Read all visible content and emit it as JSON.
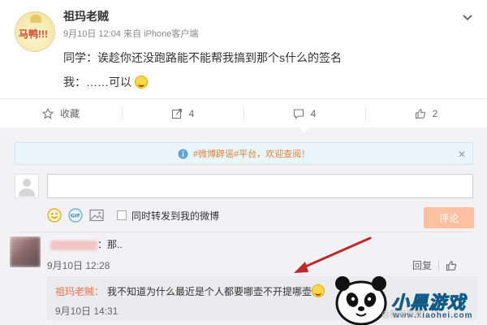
{
  "post": {
    "avatar_text": "马鸭!!!",
    "username": "祖玛老贼",
    "timestamp": "9月10日 12:04",
    "source_prefix": "来自",
    "source": "iPhone客户端",
    "content_line1": "同学：诶趁你还没跑路能不能帮我搞到那个s什么的签名",
    "content_line2": "我：……可以"
  },
  "actions": {
    "favorite_label": "收藏",
    "repost_count": "4",
    "comment_count": "4",
    "like_count": "2"
  },
  "comment_panel": {
    "notice_text": "#微博辟谣#平台，欢迎查阅！",
    "notice_close": "✕",
    "input_placeholder": "",
    "repost_checkbox_label": "同时转发到我的微博",
    "submit_label": "评论",
    "submit_color": "#ffc09f"
  },
  "comment": {
    "text": "：那..",
    "time": "9月10日 12:28",
    "reply_label": "回复",
    "like_icon": "thumbs-up-icon",
    "reply": {
      "name": "祖玛老贼：",
      "text": "我不知道为什么最近是个人都要哪壶不开提哪壶",
      "time": "9月10日 14:31"
    }
  },
  "watermark": {
    "brand": "小黑游戏",
    "url": "www.xiaohei.com",
    "faint": "@新浪游戏"
  },
  "colors": {
    "accent_orange": "#eb7350",
    "notice_bg": "#eaf4fb",
    "annotation_arrow": "#c0272d"
  }
}
